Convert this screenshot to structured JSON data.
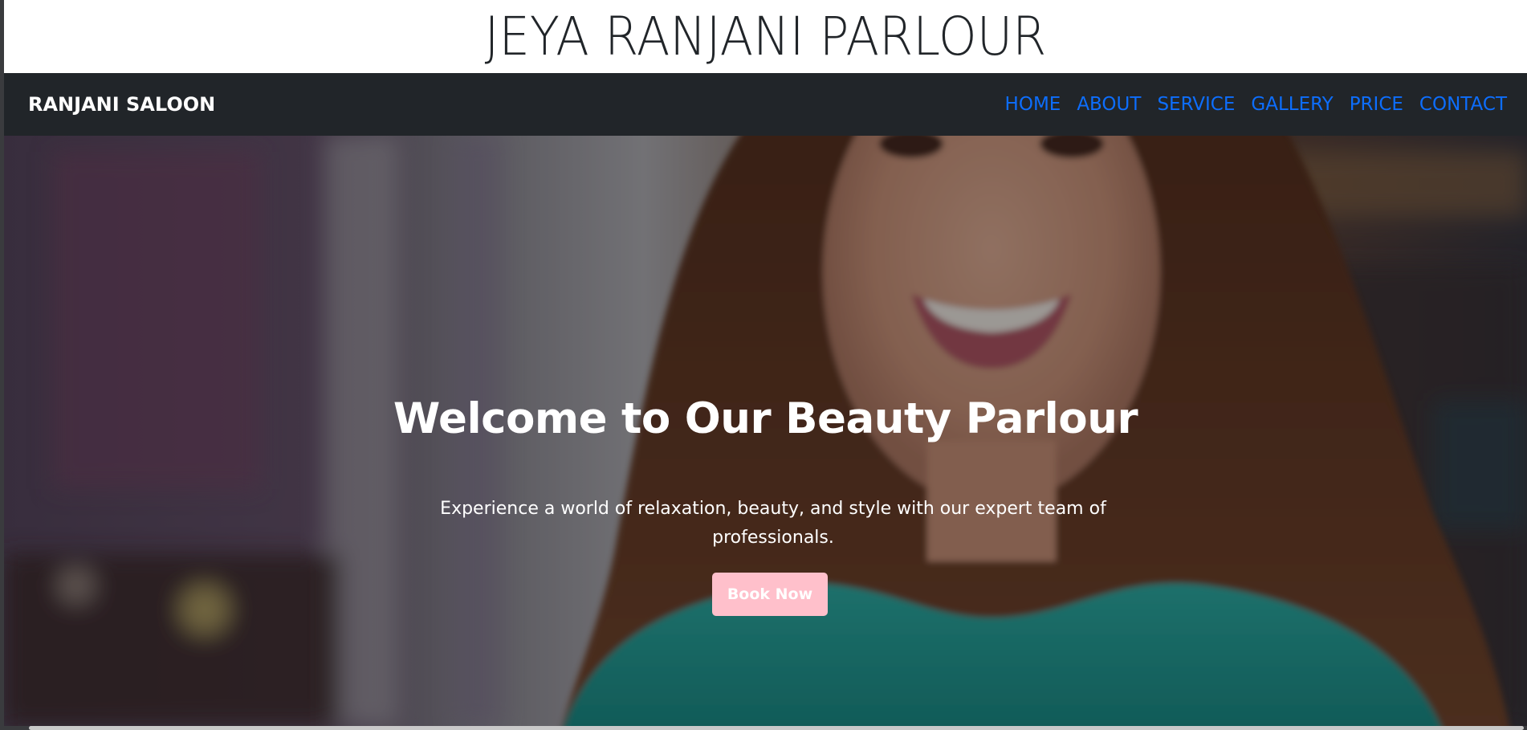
{
  "header": {
    "title": "JEYA RANJANI PARLOUR"
  },
  "navbar": {
    "brand": "RANJANI SALOON",
    "links": [
      {
        "label": "HOME"
      },
      {
        "label": "ABOUT"
      },
      {
        "label": "SERVICE"
      },
      {
        "label": "GALLERY"
      },
      {
        "label": "PRICE"
      },
      {
        "label": "CONTACT"
      }
    ],
    "link_color": "#0d6efd",
    "background": "#212529"
  },
  "hero": {
    "heading": "Welcome to Our Beauty Parlour",
    "text": "Experience a world of relaxation, beauty, and style with our expert team of professionals.",
    "button_label": "Book Now",
    "button_color": "#ffc0cb",
    "image_subject": "smiling woman with long brown hair in teal top"
  }
}
